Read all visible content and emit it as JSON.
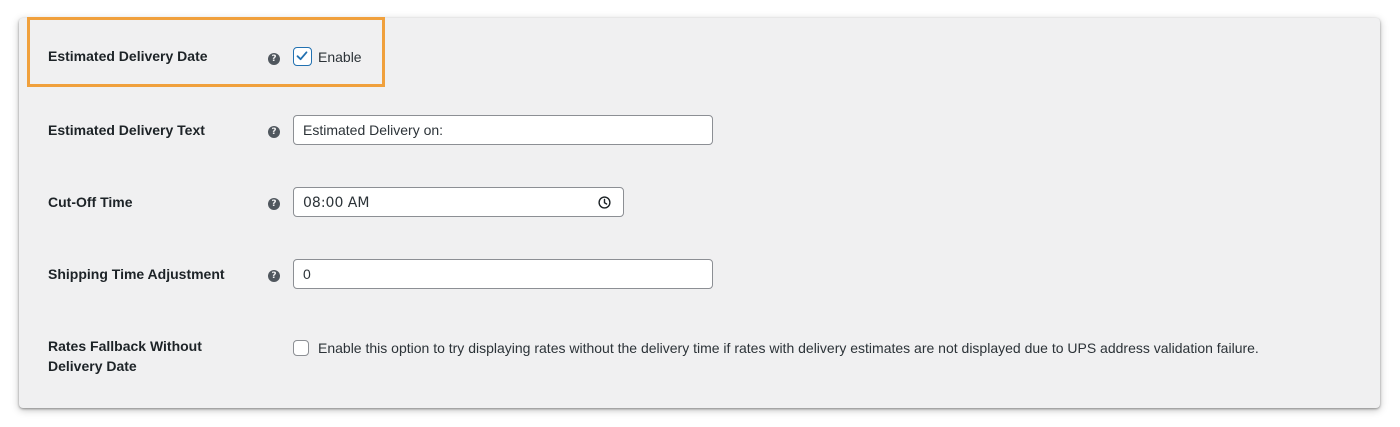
{
  "settings": {
    "estimated_delivery_date": {
      "label": "Estimated Delivery Date",
      "checkbox_label": "Enable",
      "checked": true
    },
    "estimated_delivery_text": {
      "label": "Estimated Delivery Text",
      "value": "Estimated Delivery on:"
    },
    "cut_off_time": {
      "label": "Cut-Off Time",
      "value": "08:00 AM"
    },
    "shipping_time_adjustment": {
      "label": "Shipping Time Adjustment",
      "value": "0"
    },
    "rates_fallback": {
      "label_line1": "Rates Fallback Without",
      "label_line2": "Delivery Date",
      "checkbox_label": "Enable this option to try displaying rates without the delivery time if rates with delivery estimates are not displayed due to UPS address validation failure.",
      "checked": false
    }
  },
  "icons": {
    "help": "question-circle-icon",
    "checkmark": "checkmark-icon",
    "clock": "clock-icon"
  },
  "colors": {
    "highlight": "#f0a03c",
    "panel_background": "#f0f0f1",
    "checkbox_accent": "#2271b1"
  }
}
